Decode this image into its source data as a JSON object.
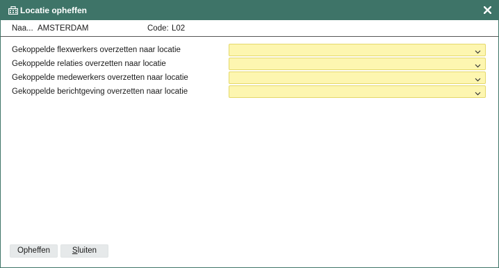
{
  "window": {
    "title": "Locatie opheffen",
    "title_icon": "building-icon",
    "close_icon": "close-icon",
    "colors": {
      "titlebar": "#3e7468",
      "select_bg": "#fdf6b0",
      "select_border": "#e4d86a",
      "button_bg": "#e6e9ea"
    }
  },
  "info": {
    "name_label": "Naa...",
    "name_value": "AMSTERDAM",
    "code_label": "Code:",
    "code_value": "L02"
  },
  "form": {
    "rows": [
      {
        "label": "Gekoppelde flexwerkers overzetten naar locatie",
        "value": ""
      },
      {
        "label": "Gekoppelde relaties overzetten naar locatie",
        "value": ""
      },
      {
        "label": "Gekoppelde medewerkers overzetten naar locatie",
        "value": ""
      },
      {
        "label": "Gekoppelde berichtgeving overzetten naar locatie",
        "value": ""
      }
    ]
  },
  "footer": {
    "opheffen_label": "Opheffen",
    "sluiten_label": "Sluiten"
  }
}
